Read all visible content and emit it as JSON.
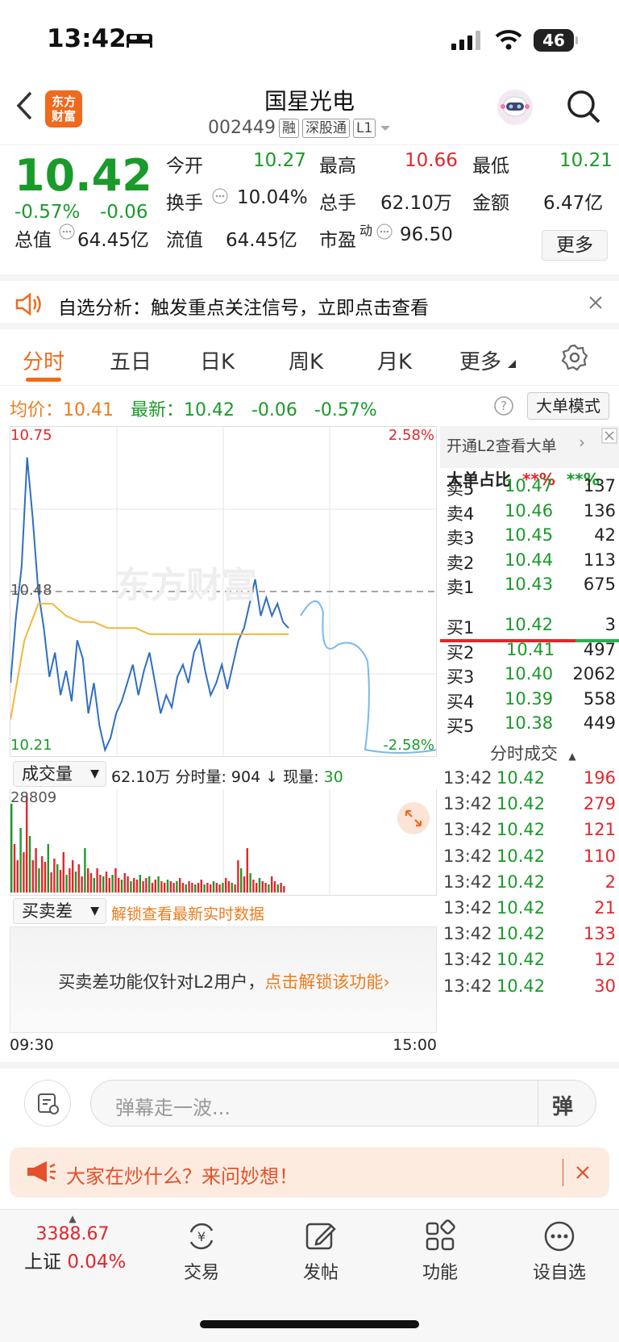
{
  "status": {
    "time": "13:42",
    "battery": "46"
  },
  "nav": {
    "logo": "东方\n财富",
    "title": "国星光电",
    "code": "002449",
    "tags": [
      "融",
      "深股通",
      "L1"
    ]
  },
  "quote": {
    "price": "10.42",
    "change_pct": "-0.57%",
    "change": "-0.06",
    "open_label": "今开",
    "open": "10.27",
    "high_label": "最高",
    "high": "10.66",
    "low_label": "最低",
    "low": "10.21",
    "turnover_label": "换手",
    "turnover": "10.04%",
    "vol_label": "总手",
    "vol": "62.10万",
    "amount_label": "金额",
    "amount": "6.47亿",
    "mcap_label": "总值",
    "mcap": "64.45亿",
    "float_label": "流值",
    "float": "64.45亿",
    "pe_label": "市盈",
    "pe_sup": "动",
    "pe": "96.50",
    "more": "更多"
  },
  "alert": {
    "text": "自选分析：触发重点关注信号，立即点击查看"
  },
  "tabs": [
    "分时",
    "五日",
    "日K",
    "周K",
    "月K",
    "更多"
  ],
  "avg": {
    "avg_label": "均价：",
    "avg": "10.41",
    "new_label": "最新：",
    "new": "10.42",
    "change": "-0.06",
    "pct": "-0.57%",
    "mode": "大单模式"
  },
  "chart": {
    "y_max": "10.75",
    "y_mid": "10.48",
    "y_min": "10.21",
    "pct_max": "2.58%",
    "pct_min": "-2.58%",
    "watermark": "东方财富"
  },
  "chart_data": {
    "type": "line",
    "series": [
      {
        "name": "分时",
        "values": [
          10.33,
          10.44,
          10.52,
          10.7,
          10.6,
          10.48,
          10.42,
          10.34,
          10.38,
          10.31,
          10.35,
          10.3,
          10.4,
          10.37,
          10.28,
          10.33,
          10.26,
          10.22,
          10.24,
          10.28,
          10.3,
          10.33,
          10.36,
          10.31,
          10.35,
          10.38,
          10.33,
          10.28,
          10.31,
          10.29,
          10.34,
          10.36,
          10.33,
          10.38,
          10.4,
          10.35,
          10.31,
          10.33,
          10.36,
          10.32,
          10.36,
          10.4,
          10.42,
          10.46,
          10.5,
          10.44,
          10.47,
          10.44,
          10.46,
          10.43,
          10.42
        ]
      },
      {
        "name": "均价",
        "values": [
          10.27,
          10.4,
          10.46,
          10.46,
          10.44,
          10.43,
          10.43,
          10.42,
          10.42,
          10.42,
          10.41,
          10.41,
          10.41,
          10.41,
          10.41,
          10.41,
          10.41,
          10.41,
          10.41,
          10.41,
          10.41
        ]
      }
    ],
    "ylim": [
      10.21,
      10.75
    ]
  },
  "volume": {
    "label": "成交量",
    "total": "62.10万",
    "seg_label": "分时量:",
    "seg": "904",
    "arrow": "↓",
    "now_label": "现量:",
    "now": "30",
    "max": "28809"
  },
  "diff": {
    "label": "买卖差",
    "link": "解锁查看最新实时数据",
    "msg": "买卖差功能仅针对L2用户，",
    "msg_link": "点击解锁该功能"
  },
  "time_axis": {
    "start": "09:30",
    "end": "15:00"
  },
  "panel": {
    "promo": "开通L2查看大单",
    "ratio_label": "大单占比",
    "ratio_red": "**%",
    "ratio_green": "**%",
    "asks": [
      {
        "l": "卖5",
        "p": "10.47",
        "v": "137"
      },
      {
        "l": "卖4",
        "p": "10.46",
        "v": "136"
      },
      {
        "l": "卖3",
        "p": "10.45",
        "v": "42"
      },
      {
        "l": "卖2",
        "p": "10.44",
        "v": "113"
      },
      {
        "l": "卖1",
        "p": "10.43",
        "v": "675"
      }
    ],
    "bids": [
      {
        "l": "买1",
        "p": "10.42",
        "v": "3"
      },
      {
        "l": "买2",
        "p": "10.41",
        "v": "497"
      },
      {
        "l": "买3",
        "p": "10.40",
        "v": "2062"
      },
      {
        "l": "买4",
        "p": "10.39",
        "v": "558"
      },
      {
        "l": "买5",
        "p": "10.38",
        "v": "449"
      }
    ],
    "ticks_label": "分时成交",
    "ticks": [
      {
        "t": "13:42",
        "p": "10.42",
        "v": "196"
      },
      {
        "t": "13:42",
        "p": "10.42",
        "v": "279"
      },
      {
        "t": "13:42",
        "p": "10.42",
        "v": "121"
      },
      {
        "t": "13:42",
        "p": "10.42",
        "v": "110"
      },
      {
        "t": "13:42",
        "p": "10.42",
        "v": "2"
      },
      {
        "t": "13:42",
        "p": "10.42",
        "v": "21"
      },
      {
        "t": "13:42",
        "p": "10.42",
        "v": "133"
      },
      {
        "t": "13:42",
        "p": "10.42",
        "v": "12"
      },
      {
        "t": "13:42",
        "p": "10.42",
        "v": "30"
      }
    ]
  },
  "danmu": {
    "placeholder": "弹幕走一波...",
    "btn": "弹"
  },
  "ask": {
    "text": "大家在炒什么？来问妙想！"
  },
  "bottom": {
    "index_val": "3388.67",
    "index_name": "上证",
    "index_pct": "0.04%",
    "items": [
      "交易",
      "发帖",
      "功能",
      "设自选"
    ]
  }
}
